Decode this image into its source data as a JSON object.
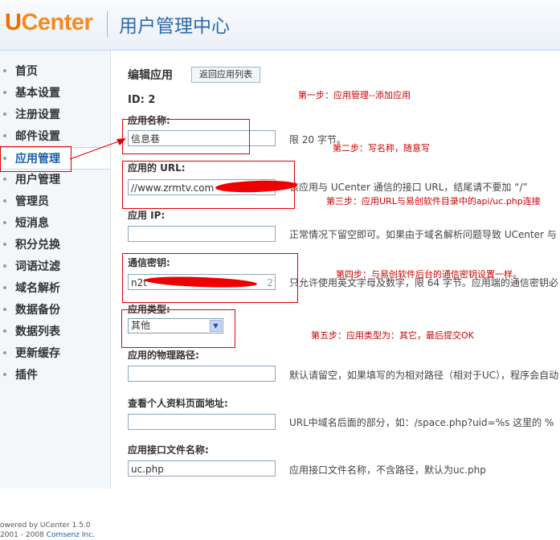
{
  "header": {
    "logo_u": "U",
    "logo_rest": "Center",
    "title": "用户管理中心"
  },
  "sidebar": {
    "items": [
      {
        "label": "首页"
      },
      {
        "label": "基本设置"
      },
      {
        "label": "注册设置"
      },
      {
        "label": "邮件设置"
      },
      {
        "label": "应用管理"
      },
      {
        "label": "用户管理"
      },
      {
        "label": "管理员"
      },
      {
        "label": "短消息"
      },
      {
        "label": "积分兑换"
      },
      {
        "label": "词语过滤"
      },
      {
        "label": "域名解析"
      },
      {
        "label": "数据备份"
      },
      {
        "label": "数据列表"
      },
      {
        "label": "更新缓存"
      },
      {
        "label": "插件"
      }
    ],
    "active_index": 4,
    "footer_line1": "owered by UCenter 1.5.0",
    "footer_line2": "2001 - 2008",
    "footer_link": "Comsenz Inc."
  },
  "main": {
    "title": "编辑应用",
    "back_button": "返回应用列表",
    "id_text": "ID: 2",
    "fields": {
      "name": {
        "label": "应用名称:",
        "value": "信息巷",
        "hint": "限 20 字节。"
      },
      "url": {
        "label": "应用的 URL:",
        "value": "//www.zrmtv.com",
        "hint": "该应用与 UCenter 通信的接口 URL，结尾请不要加 “/”"
      },
      "ip": {
        "label": "应用 IP:",
        "value": "",
        "hint": "正常情况下留空即可。如果由于域名解析问题导致 UCenter 与"
      },
      "key": {
        "label": "通信密钥:",
        "value": "n2t",
        "value_tail": "2",
        "hint": "只允许使用英文字母及数字，限 64 字节。应用端的通信密钥必"
      },
      "type": {
        "label": "应用类型:",
        "value": "其他"
      },
      "path": {
        "label": "应用的物理路径:",
        "value": "",
        "hint": "默认请留空，如果填写的为相对路径（相对于UC），程序会自动"
      },
      "profile": {
        "label": "查看个人资料页面地址:",
        "value": "",
        "hint": "URL中域名后面的部分，如：/space.php?uid=%s 这里的 %"
      },
      "api": {
        "label": "应用接口文件名称:",
        "value": "uc.php",
        "hint": "应用接口文件名称，不含路径，默认为uc.php"
      }
    }
  },
  "annotations": {
    "step1": "第一步：应用管理--添加应用",
    "step2": "第二步：写名称，随意写",
    "step3": "第三步：应用URL与易创软件目录中的api/uc.php连接",
    "step4": "第四步：与易创软件后台的通信密钥设置一样。",
    "step5": "第五步：应用类型为：其它，最后提交OK"
  }
}
